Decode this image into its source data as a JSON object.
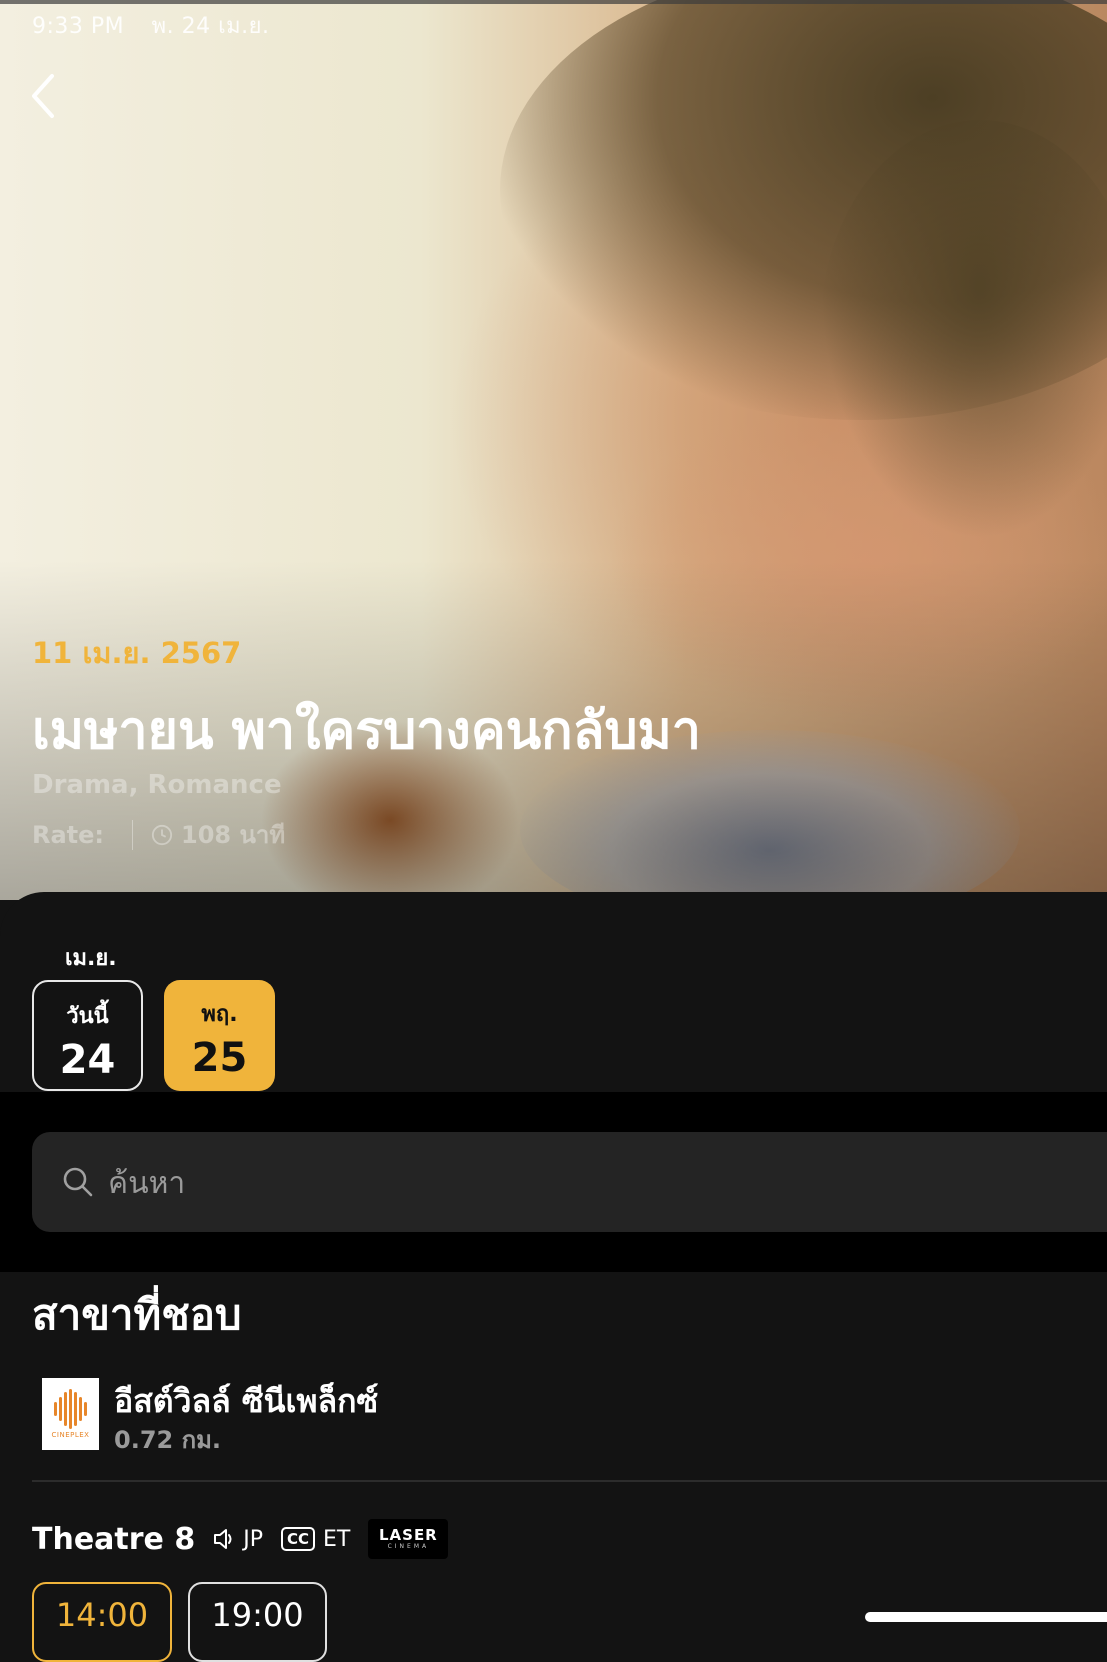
{
  "status_bar": {
    "time": "9:33 PM",
    "date": "พ. 24 เม.ย."
  },
  "movie": {
    "release_date": "11 เม.ย. 2567",
    "title": "เมษายน พาใครบางคนกลับมา",
    "genre": "Drama, Romance",
    "rate_label": "Rate:",
    "duration": "108 นาที"
  },
  "dates": {
    "month_label": "เม.ย.",
    "items": [
      {
        "dow": "วันนี้",
        "day": "24"
      },
      {
        "dow": "พฤ.",
        "day": "25"
      }
    ]
  },
  "search": {
    "placeholder": "ค้นหา"
  },
  "favorites": {
    "title": "สาขาที่ชอบ",
    "cinema": {
      "name": "อีสต์วิลล์ ซีนีเพล็กซ์",
      "distance": "0.72 กม.",
      "logo_text": "CINEPLEX"
    }
  },
  "theatre": {
    "name": "Theatre 8",
    "audio": "JP",
    "cc_label": "CC",
    "subtitle": "ET",
    "format_line1": "LASER",
    "format_line2": "CINEMA",
    "times": [
      "14:00",
      "19:00"
    ]
  },
  "colors": {
    "accent": "#f0b43b",
    "background": "#131313",
    "search_bg": "#242424"
  }
}
